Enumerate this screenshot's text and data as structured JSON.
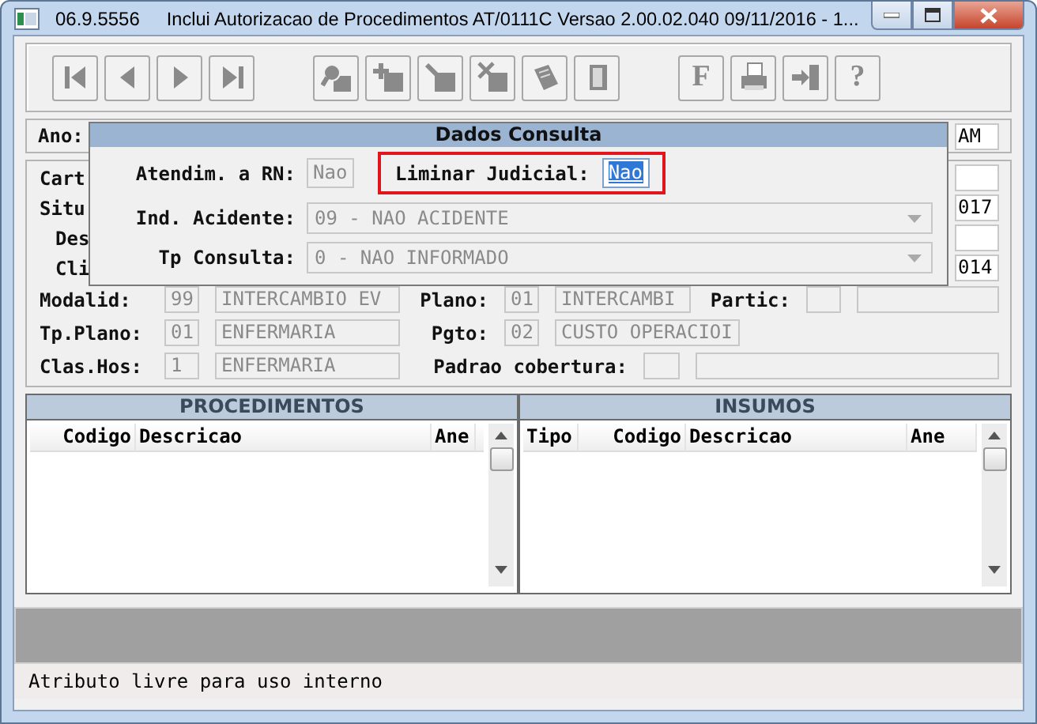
{
  "window": {
    "code": "06.9.5556",
    "title": "Inclui  Autorizacao de Procedimentos AT/0111C Versao 2.00.02.040 09/11/2016 - 1..."
  },
  "toolbar": [
    [
      {
        "kind": "first"
      },
      {
        "kind": "prev"
      },
      {
        "kind": "next"
      },
      {
        "kind": "last"
      }
    ],
    [
      {
        "kind": "search"
      },
      {
        "kind": "add"
      },
      {
        "kind": "edit"
      },
      {
        "kind": "delete"
      },
      {
        "kind": "notes"
      },
      {
        "kind": "door"
      }
    ],
    [
      {
        "kind": "letter",
        "label": "F"
      },
      {
        "kind": "print"
      },
      {
        "kind": "exit"
      },
      {
        "kind": "letter",
        "label": "?"
      }
    ]
  ],
  "year_row": {
    "label": "Ano:",
    "value": "AM"
  },
  "partial_rows": [
    {
      "label": "Cart",
      "kind": "main"
    },
    {
      "label": "Situ",
      "kind": "main",
      "value": "017"
    },
    {
      "label": "Des",
      "kind": "sub"
    },
    {
      "label": "Cli",
      "kind": "sub",
      "value": "014"
    }
  ],
  "detail_rows": [
    [
      {
        "kind": "label",
        "text": "Modalid:"
      },
      {
        "kind": "field",
        "text": "99",
        "disabled": true
      },
      {
        "kind": "field",
        "text": "INTERCAMBIO EV",
        "disabled": true
      },
      {
        "kind": "label",
        "text": "Plano:"
      },
      {
        "kind": "field",
        "text": "01",
        "disabled": true
      },
      {
        "kind": "field",
        "text": "INTERCAMBI",
        "disabled": true
      },
      {
        "kind": "label",
        "text": "Partic:"
      },
      {
        "kind": "field",
        "disabled": true
      },
      {
        "kind": "field",
        "disabled": true
      }
    ],
    [
      {
        "kind": "label",
        "text": "Tp.Plano:"
      },
      {
        "kind": "field",
        "text": "01",
        "disabled": true
      },
      {
        "kind": "field",
        "text": "ENFERMARIA",
        "disabled": true
      },
      {
        "kind": "label",
        "text": "Pgto:"
      },
      {
        "kind": "field",
        "text": "02",
        "disabled": true
      },
      {
        "kind": "field",
        "text": "CUSTO OPERACIOI",
        "disabled": true
      }
    ],
    [
      {
        "kind": "label",
        "text": "Clas.Hos:"
      },
      {
        "kind": "field",
        "text": "1",
        "disabled": true
      },
      {
        "kind": "field",
        "text": "ENFERMARIA",
        "disabled": true
      },
      {
        "kind": "label",
        "text": "Padrao cobertura:"
      },
      {
        "kind": "field",
        "disabled": true
      },
      {
        "kind": "field",
        "disabled": true
      }
    ]
  ],
  "dialog": {
    "title": "Dados Consulta",
    "fields": [
      {
        "kind": "text",
        "label": "Atendim. a RN:",
        "value": "Nao",
        "disabled": true,
        "selected": false,
        "highlighted": false
      },
      {
        "kind": "text",
        "label": "Liminar Judicial:",
        "value": "Nao",
        "disabled": false,
        "selected": true,
        "highlighted": true
      },
      {
        "kind": "combo",
        "label": "Ind. Acidente:",
        "value": "09 - NAO ACIDENTE",
        "disabled": true
      },
      {
        "kind": "combo",
        "label": "Tp Consulta:",
        "value": "0 - NAO INFORMADO",
        "disabled": true
      }
    ]
  },
  "grids": [
    {
      "title": "PROCEDIMENTOS",
      "columns": [
        "Codigo",
        "Descricao",
        "Ane"
      ]
    },
    {
      "title": "INSUMOS",
      "columns": [
        "Tipo",
        "Codigo",
        "Descricao",
        "Ane"
      ]
    }
  ],
  "status_bar": "Atributo livre para uso interno"
}
